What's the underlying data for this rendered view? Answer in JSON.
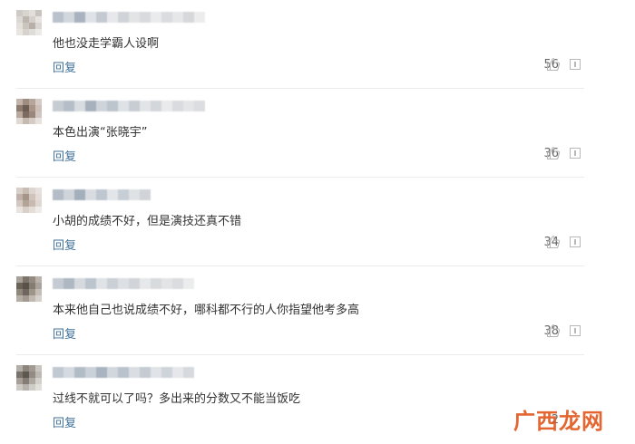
{
  "comments": [
    {
      "text": "他也没走学霸人设啊",
      "reply": "回复",
      "likes": "56"
    },
    {
      "text": "本色出演“张晓宇”",
      "reply": "回复",
      "likes": "36"
    },
    {
      "text": "小胡的成绩不好，但是演技还真不错",
      "reply": "回复",
      "likes": "34"
    },
    {
      "text": "本来他自己也说成绩不好，哪科都不行的人你指望他考多高",
      "reply": "回复",
      "likes": "38"
    },
    {
      "text": "过线不就可以了吗？多出来的分数又不能当饭吃",
      "reply": "回复",
      "likes": "2"
    }
  ],
  "watermark": {
    "text": "广西龙网"
  },
  "colors": {
    "reply": "#41729a",
    "text": "#333333",
    "count": "#666666",
    "watermark": "#e2581f"
  },
  "icons": {
    "like": "thumbs-up-icon",
    "report": "report-icon",
    "avatar": "pixelated-avatar"
  }
}
